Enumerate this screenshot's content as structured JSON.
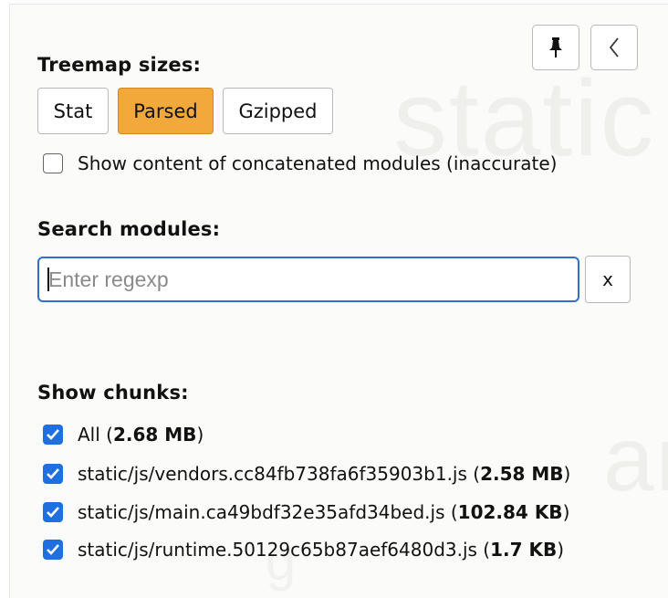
{
  "background_words": [
    "static",
    "an",
    "g"
  ],
  "toolbar": {
    "pin_icon": "pin-icon",
    "collapse_icon": "chevron-left-icon"
  },
  "treemap": {
    "title": "Treemap sizes:",
    "options": [
      "Stat",
      "Parsed",
      "Gzipped"
    ],
    "selected": "Parsed",
    "concatenated_label": "Show content of concatenated modules (inaccurate)",
    "concatenated_checked": false
  },
  "search": {
    "title": "Search modules:",
    "placeholder": "Enter regexp",
    "value": "",
    "clear_label": "x"
  },
  "chunks": {
    "title": "Show chunks:",
    "items": [
      {
        "name": "All",
        "size": "2.68 MB",
        "checked": true
      },
      {
        "name": "static/js/vendors.cc84fb738fa6f35903b1.js",
        "size": "2.58 MB",
        "checked": true
      },
      {
        "name": "static/js/main.ca49bdf32e35afd34bed.js",
        "size": "102.84 KB",
        "checked": true
      },
      {
        "name": "static/js/runtime.50129c65b87aef6480d3.js",
        "size": "1.7 KB",
        "checked": true
      }
    ]
  },
  "colors": {
    "accent": "#f3a83b",
    "checkbox": "#1f6fe0",
    "focus": "#2f6fd0"
  }
}
